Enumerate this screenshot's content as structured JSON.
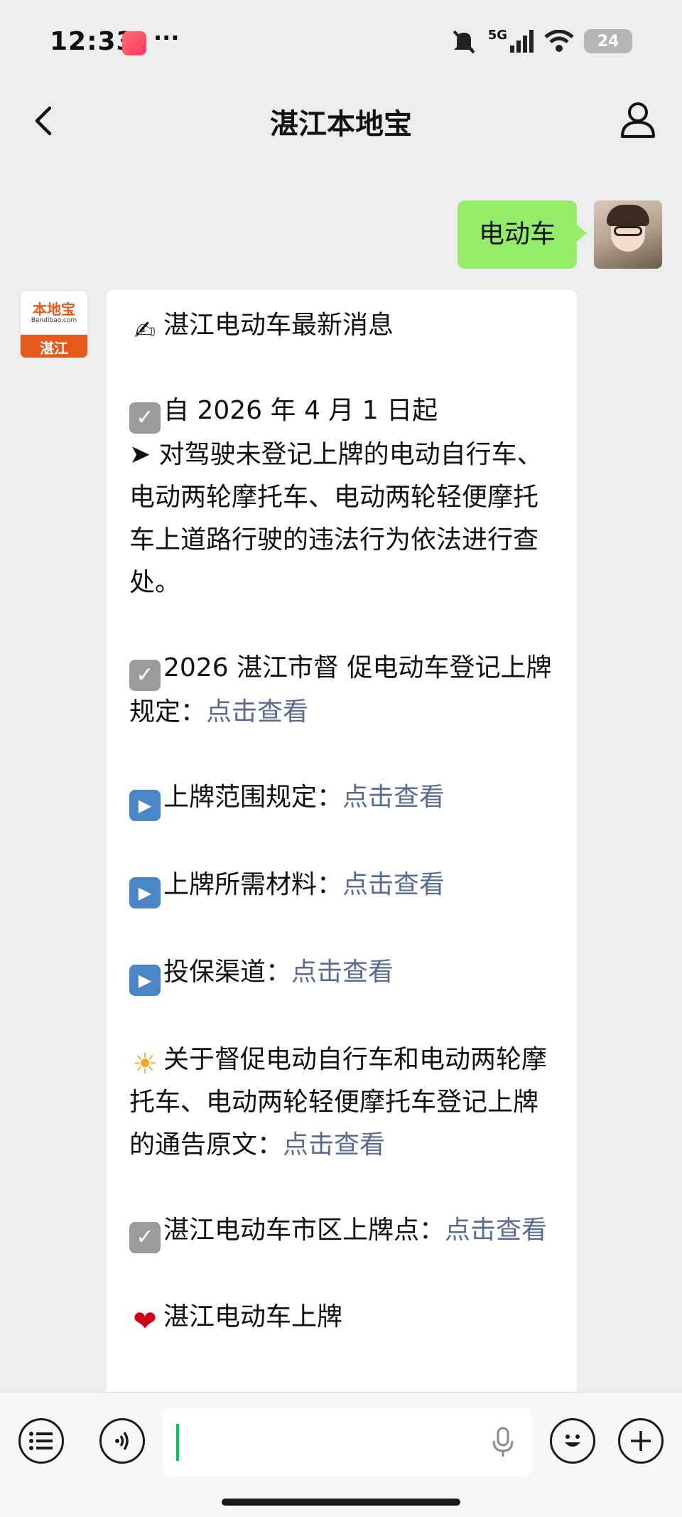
{
  "status_bar": {
    "time": "12:33",
    "more": "···",
    "network": "5G",
    "battery": "24"
  },
  "nav": {
    "title": "湛江本地宝",
    "back_icon": "chevron-left-icon",
    "profile_icon": "person-icon"
  },
  "user_message": {
    "text": "电动车"
  },
  "bot": {
    "avatar_brand": "本地宝",
    "avatar_url": "Bendibao.com",
    "avatar_city": "湛江",
    "lines": {
      "l1": "湛江电动车最新消息",
      "l2": "自 2026 年 4 月 1 日起",
      "l3": "➤ 对驾驶未登记上牌的电动自行车、电动两轮摩托车、电动两轮轻便摩托车上道路行驶的违法行为依法进行查处。",
      "l4_text": "2026 湛江市督 促电动车登记上牌规定：",
      "l4_link": "点击查看",
      "l5_text": "上牌范围规定：",
      "l5_link": "点击查看",
      "l6_text": "上牌所需材料：",
      "l6_link": "点击查看",
      "l7_text": "投保渠道：",
      "l7_link": "点击查看",
      "l8_text": "关于督促电动自行车和电动两轮摩托车、电动两轮轻便摩托车登记上牌的通告原文：",
      "l8_link": "点击查看",
      "l9_text": "湛江电动车市区上牌点：",
      "l9_link": "点击查看",
      "l10": "湛江电动车上牌"
    }
  },
  "input_bar": {
    "menu_icon": "menu-list-icon",
    "voice_icon": "voice-icon",
    "mic_icon": "microphone-icon",
    "emoji_icon": "emoji-icon",
    "plus_icon": "plus-icon"
  }
}
